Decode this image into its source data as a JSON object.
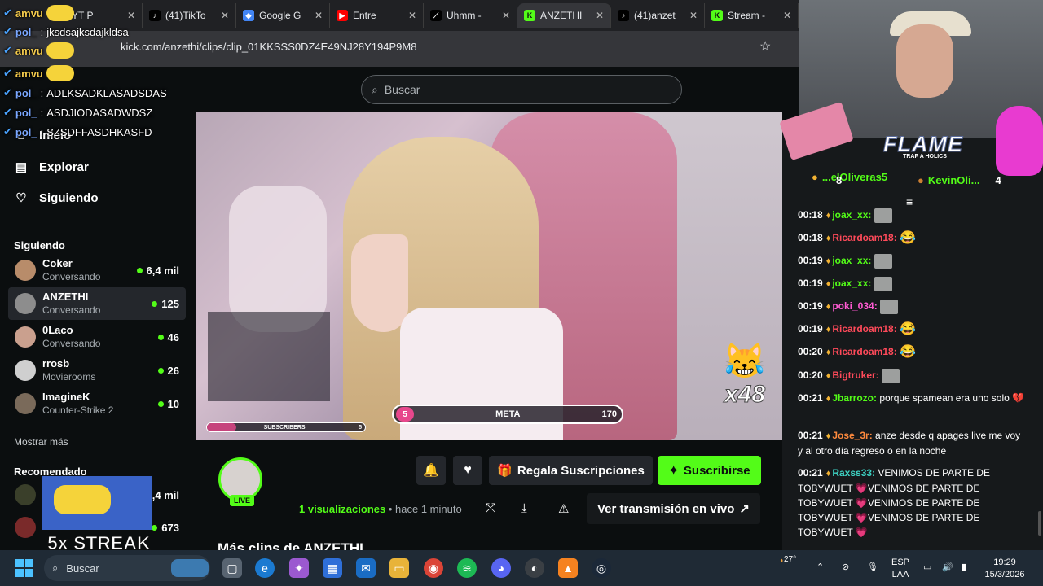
{
  "browser": {
    "tabs": [
      {
        "title": "YT P",
        "fav_color": "#f5d33a",
        "fav_text": "",
        "active": false
      },
      {
        "title": "(41)TikTo",
        "fav_color": "#000000",
        "fav_text": "♪",
        "active": false
      },
      {
        "title": "Google G",
        "fav_color": "#4285f4",
        "fav_text": "◆",
        "active": false
      },
      {
        "title": "Entre",
        "fav_color": "#ff0000",
        "fav_text": "▶",
        "active": false
      },
      {
        "title": "Uhmm - ",
        "fav_color": "#000000",
        "fav_text": "⟋",
        "active": false
      },
      {
        "title": "ANZETHI",
        "fav_color": "#53fc18",
        "fav_text": "K",
        "active": true
      },
      {
        "title": "(41)anzet",
        "fav_color": "#000000",
        "fav_text": "♪",
        "active": false
      },
      {
        "title": "Stream - ",
        "fav_color": "#53fc18",
        "fav_text": "K",
        "active": false
      }
    ],
    "url": "kick.com/anzethi/clips/clip_01KKSSS0DZ4E49NJ28Y194P9M8"
  },
  "overlay_chat": [
    {
      "user": "amvu",
      "msg": "",
      "type": "minion"
    },
    {
      "user": "pol_",
      "msg": "jksdsajksdajkldsa",
      "type": "text"
    },
    {
      "user": "amvu",
      "msg": "",
      "type": "minion"
    },
    {
      "user": "amvu",
      "msg": "",
      "type": "minion"
    },
    {
      "user": "pol_",
      "msg": "ADLKSADKLASADSDAS",
      "type": "text"
    },
    {
      "user": "pol_",
      "msg": "ASDJIODASADWDSZ",
      "type": "text"
    },
    {
      "user": "pol_",
      "msg": "SZSDFFASDHKASFD",
      "type": "text"
    }
  ],
  "kick": {
    "search_placeholder": "Buscar",
    "nav": {
      "home": "Inicio",
      "explore": "Explorar",
      "following": "Siguiendo"
    },
    "following_title": "Siguiendo",
    "following": [
      {
        "name": "Coker",
        "category": "Conversando",
        "viewers": "6,4 mil",
        "selected": false
      },
      {
        "name": "ANZETHI",
        "category": "Conversando",
        "viewers": "125",
        "selected": true
      },
      {
        "name": "0Laco",
        "category": "Conversando",
        "viewers": "46",
        "selected": false
      },
      {
        "name": "rrosb",
        "category": "Movierooms",
        "viewers": "26",
        "selected": false
      },
      {
        "name": "ImagineK",
        "category": "Counter-Strike 2",
        "viewers": "10",
        "selected": false
      }
    ],
    "show_more": "Mostrar más",
    "recommended_title": "Recomendado",
    "recommended": [
      {
        "viewers": "1,4 mil"
      },
      {
        "viewers": "673"
      }
    ],
    "video": {
      "meta_label": "META",
      "meta_left": "5",
      "meta_right": "170",
      "subs_label": "SUBSCRIBERS",
      "subs_right": "5",
      "emote_mult": "x48"
    },
    "live_badge": "LIVE",
    "gift_button": "Regala Suscripciones",
    "subscribe_button": "Suscribirse",
    "views_count": "1 visualizaciones",
    "views_time": "• hace 1 minuto",
    "watch_live": "Ver transmisión en vivo",
    "more_clips": "Más clips de ANZETHI"
  },
  "chat": {
    "top_gifters": [
      {
        "name": "...elOliveras5",
        "count": "8"
      },
      {
        "name": "KevinOli...",
        "count": "4"
      }
    ],
    "messages": [
      {
        "time": "00:18",
        "user": "joax_xx",
        "color": "#53fc18",
        "text": "",
        "emote": "img"
      },
      {
        "time": "00:18",
        "user": "Ricardoam18",
        "color": "#ff4a5a",
        "text": "",
        "emote": "😂"
      },
      {
        "time": "00:19",
        "user": "joax_xx",
        "color": "#53fc18",
        "text": "",
        "emote": "img"
      },
      {
        "time": "00:19",
        "user": "joax_xx",
        "color": "#53fc18",
        "text": "",
        "emote": "img"
      },
      {
        "time": "00:19",
        "user": "poki_034",
        "color": "#ff5ad2",
        "text": "",
        "emote": "img"
      },
      {
        "time": "00:19",
        "user": "Ricardoam18",
        "color": "#ff4a5a",
        "text": "",
        "emote": "😂"
      },
      {
        "time": "00:20",
        "user": "Ricardoam18",
        "color": "#ff4a5a",
        "text": "",
        "emote": "😂"
      },
      {
        "time": "00:20",
        "user": "Bigtruker",
        "color": "#ff4a5a",
        "text": "",
        "emote": "img"
      },
      {
        "time": "00:21",
        "user": "Jbarrozo",
        "color": "#53fc18",
        "text": "porque spamean era uno solo 💔",
        "emote": ""
      },
      {
        "time": "00:21",
        "user": "Jose_3r",
        "color": "#ff8a3d",
        "text": "anze desde q apages live me voy y al otro día regreso o en la noche",
        "emote": ""
      },
      {
        "time": "00:21",
        "user": "Raxss33",
        "color": "#3ed3c4",
        "text": "VENIMOS DE PARTE DE TOBYWUET 💗VENIMOS DE PARTE DE TOBYWUET 💗VENIMOS DE PARTE DE TOBYWUET 💗VENIMOS DE PARTE DE TOBYWUET 💗",
        "emote": ""
      }
    ]
  },
  "stream_overlay": {
    "flame_text": "FLAME",
    "flame_sub": "TRAP A HOLICS",
    "streak_text": "5x STREAK"
  },
  "taskbar": {
    "search_label": "Buscar",
    "weather": "27°",
    "lang_top": "ESP",
    "lang_bottom": "LAA",
    "time": "19:29",
    "date": "15/3/2026"
  }
}
